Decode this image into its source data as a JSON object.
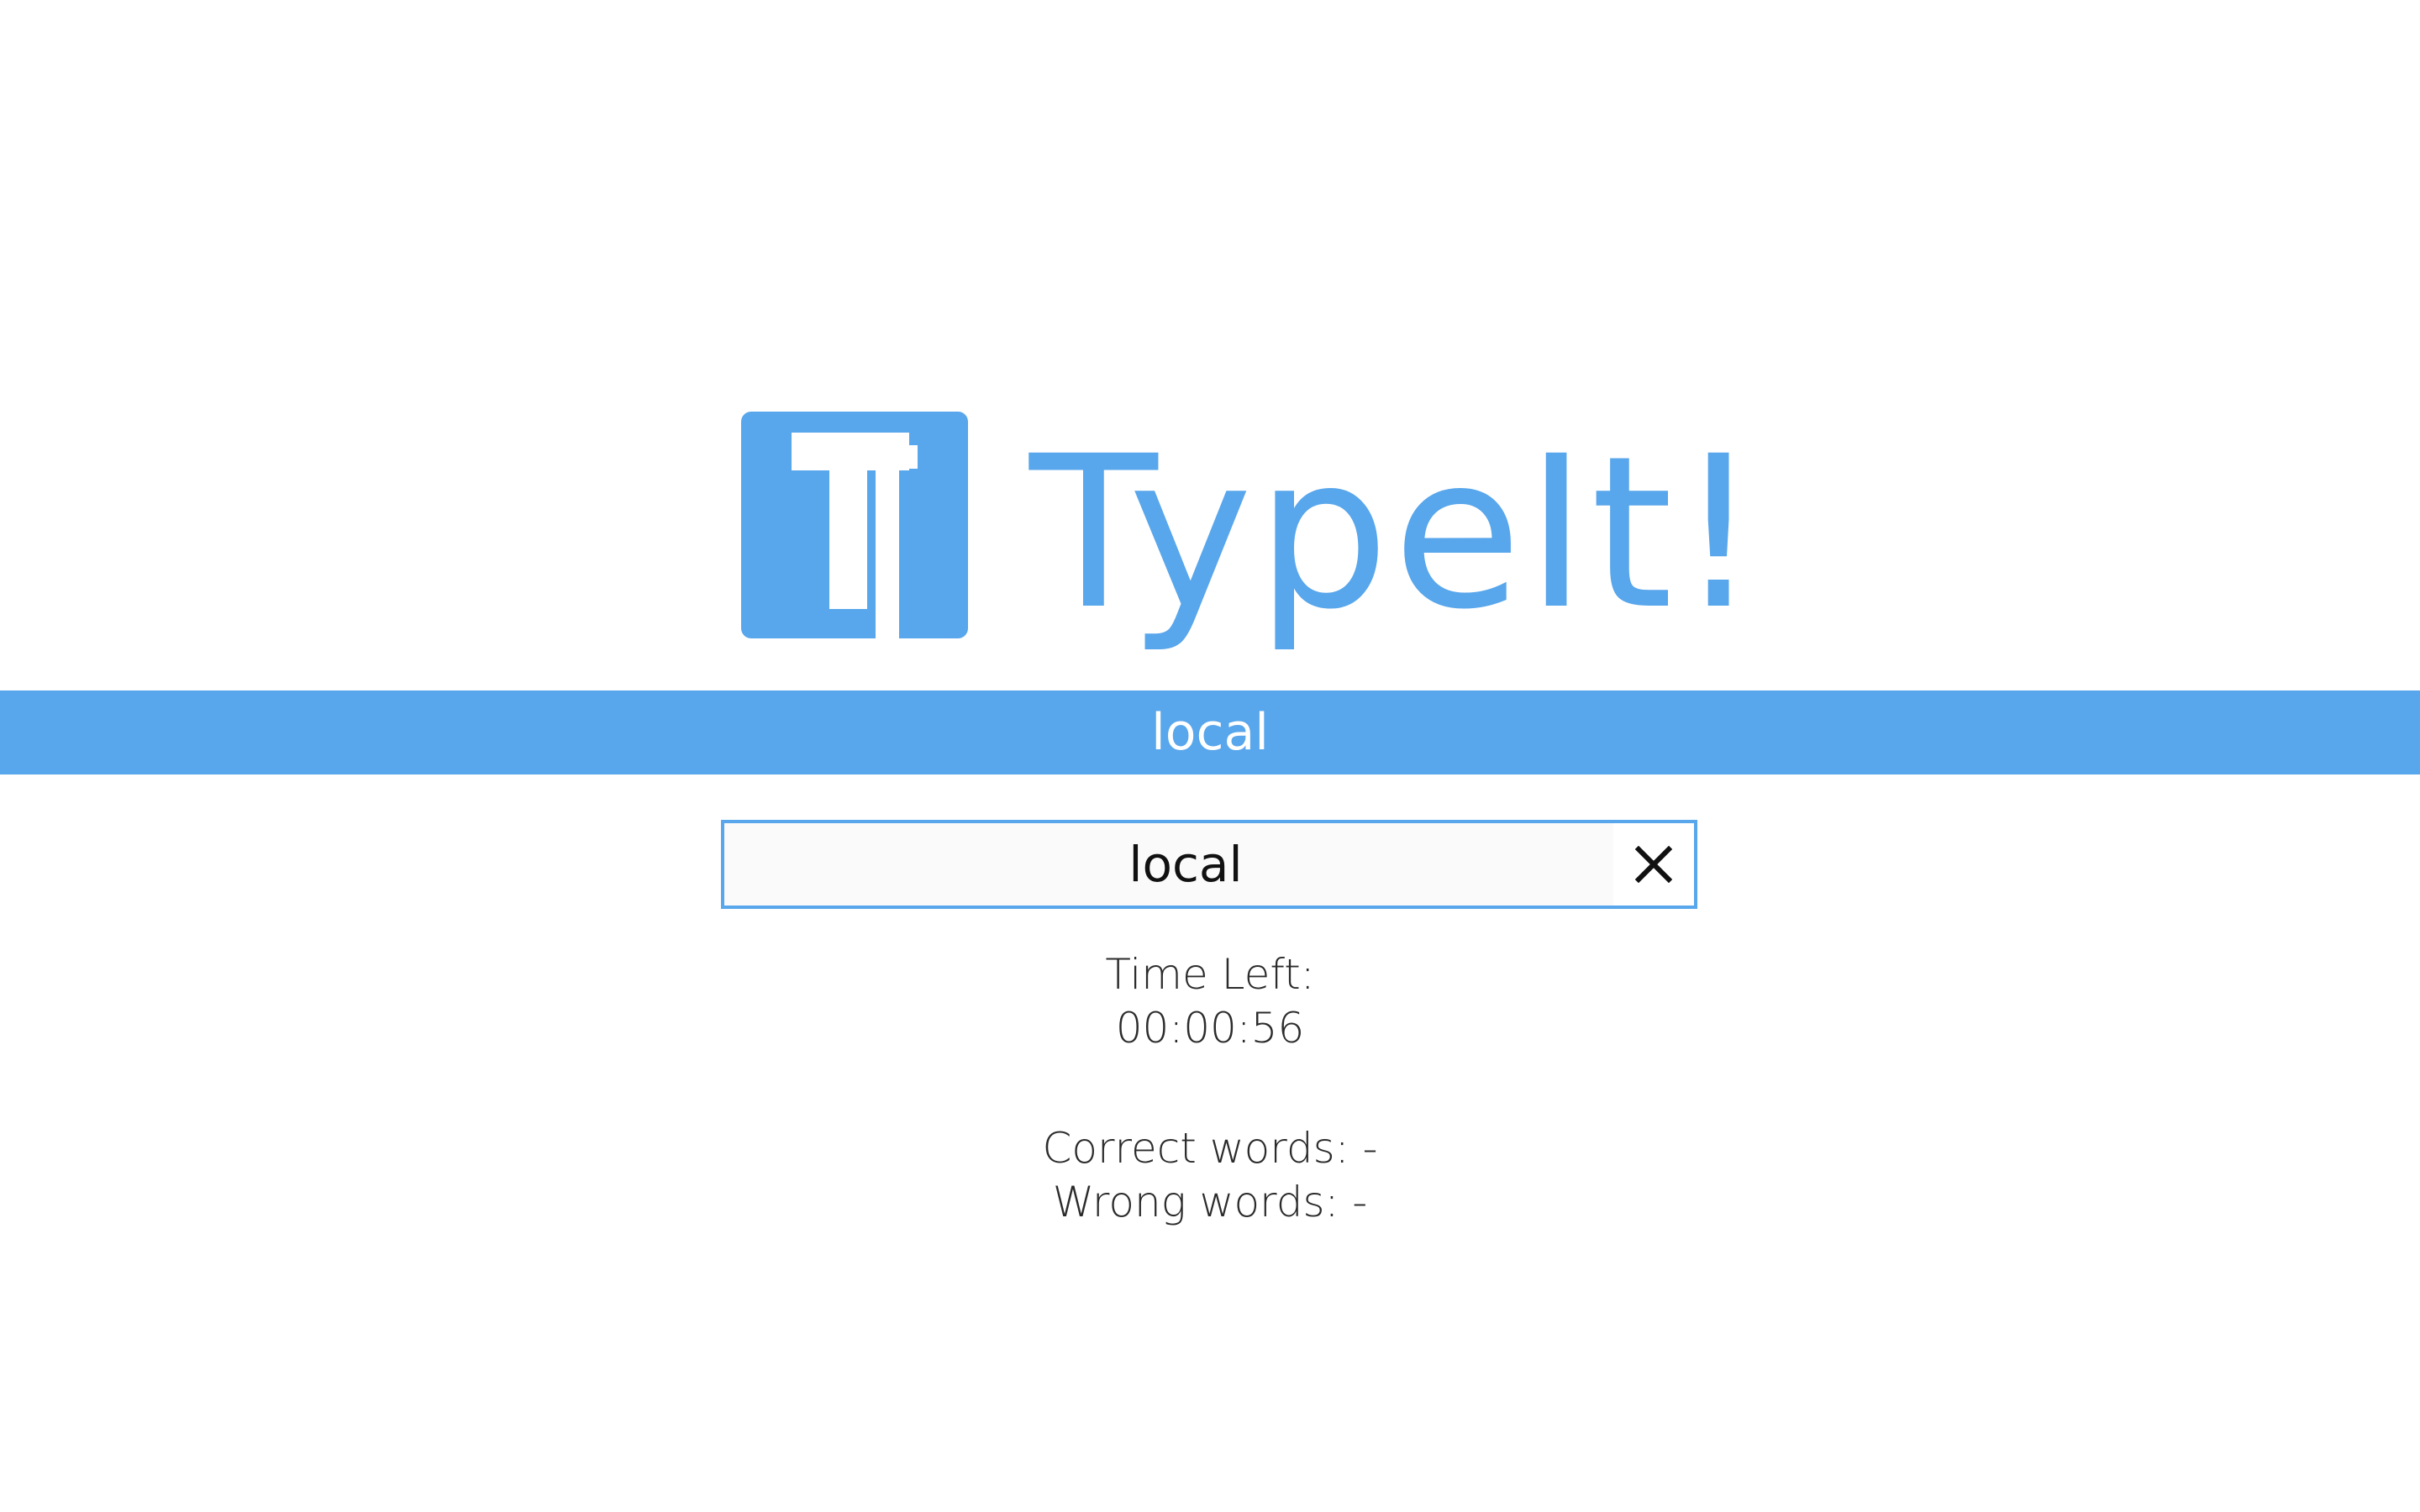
{
  "app": {
    "logo_text": "TypeIt!",
    "brand_color": "#58a6eb"
  },
  "banner": {
    "current_word": "local"
  },
  "input": {
    "value": "local",
    "clear_icon": "close-icon"
  },
  "timer": {
    "label": "Time Left:",
    "value": "00:00:56"
  },
  "results": {
    "correct_label": "Correct words: -",
    "wrong_label": "Wrong words: -"
  }
}
